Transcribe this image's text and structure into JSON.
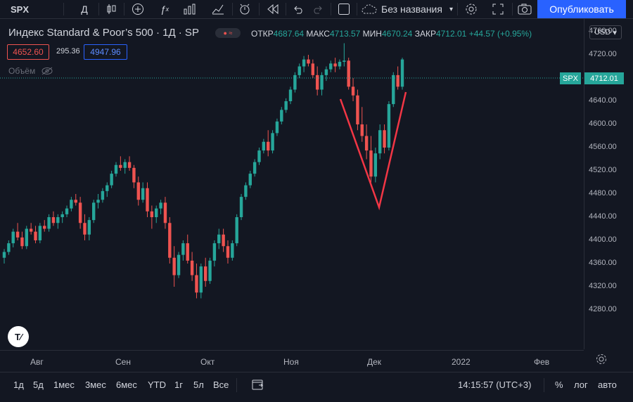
{
  "toolbar": {
    "symbol": "SPX",
    "interval": "Д",
    "layout_name": "Без названия",
    "publish_label": "Опубликовать",
    "icons": [
      "candles-icon",
      "add-indicator-icon",
      "indicators-icon",
      "templates-icon",
      "layout-icon",
      "alert-icon",
      "replay-icon",
      "undo-icon",
      "redo-icon",
      "fullscreen-icon",
      "settings-icon",
      "expand-icon",
      "snapshot-icon"
    ]
  },
  "legend": {
    "title": "Индекс Standard & Poor’s 500 · 1Д · SP",
    "open_label": "ОТКР",
    "open": "4687.64",
    "high_label": "МАКС",
    "high": "4713.57",
    "low_label": "МИН",
    "low": "4670.24",
    "close_label": "ЗАКР",
    "close": "4712.01",
    "change": "+44.57 (+0.95%)",
    "sell_price": "4652.60",
    "spread": "295.36",
    "buy_price": "4947.96",
    "volume_label": "Объём"
  },
  "price_axis": {
    "currency": "USD",
    "ticks": [
      "4760.00",
      "4720.00",
      "4680.00",
      "4640.00",
      "4600.00",
      "4560.00",
      "4520.00",
      "4480.00",
      "4440.00",
      "4400.00",
      "4360.00",
      "4320.00",
      "4280.00"
    ],
    "symbol_tag": "SPX",
    "last_price": "4712.01"
  },
  "time_axis": {
    "ticks": [
      "Авг",
      "Сен",
      "Окт",
      "Ноя",
      "Дек",
      "2022",
      "Фев"
    ]
  },
  "bottom": {
    "ranges": [
      "1д",
      "5д",
      "1мес",
      "3мес",
      "6мес",
      "YTD",
      "1г",
      "5л",
      "Все"
    ],
    "time": "14:15:57 (UTC+3)",
    "percent": "%",
    "log": "лог",
    "auto": "авто"
  },
  "chart_data": {
    "type": "candlestick",
    "y_range": [
      4260,
      4780
    ],
    "up_color": "#26a69a",
    "down_color": "#ef5350",
    "annotation": "red V-shape drawing",
    "candles": [
      [
        4370,
        4385,
        4360,
        4380
      ],
      [
        4380,
        4400,
        4375,
        4395
      ],
      [
        4395,
        4420,
        4388,
        4415
      ],
      [
        4415,
        4430,
        4400,
        4405
      ],
      [
        4405,
        4415,
        4385,
        4390
      ],
      [
        4390,
        4425,
        4385,
        4420
      ],
      [
        4420,
        4430,
        4410,
        4415
      ],
      [
        4415,
        4425,
        4395,
        4400
      ],
      [
        4400,
        4430,
        4395,
        4425
      ],
      [
        4425,
        4435,
        4415,
        4420
      ],
      [
        4420,
        4445,
        4415,
        4440
      ],
      [
        4440,
        4450,
        4425,
        4430
      ],
      [
        4430,
        4445,
        4420,
        4440
      ],
      [
        4440,
        4450,
        4430,
        4445
      ],
      [
        4445,
        4460,
        4440,
        4455
      ],
      [
        4455,
        4475,
        4450,
        4470
      ],
      [
        4470,
        4480,
        4460,
        4465
      ],
      [
        4465,
        4475,
        4420,
        4430
      ],
      [
        4430,
        4445,
        4400,
        4410
      ],
      [
        4410,
        4440,
        4400,
        4435
      ],
      [
        4435,
        4470,
        4430,
        4465
      ],
      [
        4465,
        4480,
        4455,
        4470
      ],
      [
        4470,
        4490,
        4465,
        4485
      ],
      [
        4485,
        4500,
        4475,
        4495
      ],
      [
        4495,
        4520,
        4490,
        4515
      ],
      [
        4515,
        4535,
        4510,
        4530
      ],
      [
        4530,
        4545,
        4520,
        4525
      ],
      [
        4525,
        4540,
        4515,
        4535
      ],
      [
        4535,
        4545,
        4520,
        4525
      ],
      [
        4525,
        4530,
        4490,
        4500
      ],
      [
        4500,
        4510,
        4460,
        4470
      ],
      [
        4470,
        4500,
        4465,
        4490
      ],
      [
        4490,
        4500,
        4440,
        4450
      ],
      [
        4450,
        4460,
        4420,
        4440
      ],
      [
        4440,
        4460,
        4430,
        4455
      ],
      [
        4455,
        4470,
        4445,
        4465
      ],
      [
        4465,
        4475,
        4420,
        4430
      ],
      [
        4430,
        4440,
        4360,
        4370
      ],
      [
        4370,
        4390,
        4320,
        4340
      ],
      [
        4340,
        4380,
        4335,
        4375
      ],
      [
        4375,
        4400,
        4365,
        4395
      ],
      [
        4395,
        4410,
        4360,
        4365
      ],
      [
        4365,
        4380,
        4330,
        4340
      ],
      [
        4340,
        4360,
        4300,
        4310
      ],
      [
        4310,
        4360,
        4300,
        4355
      ],
      [
        4355,
        4370,
        4320,
        4330
      ],
      [
        4330,
        4370,
        4325,
        4365
      ],
      [
        4365,
        4400,
        4355,
        4395
      ],
      [
        4395,
        4420,
        4385,
        4410
      ],
      [
        4410,
        4420,
        4380,
        4390
      ],
      [
        4390,
        4400,
        4360,
        4370
      ],
      [
        4370,
        4400,
        4365,
        4395
      ],
      [
        4395,
        4445,
        4390,
        4440
      ],
      [
        4440,
        4480,
        4435,
        4475
      ],
      [
        4475,
        4500,
        4470,
        4495
      ],
      [
        4495,
        4520,
        4490,
        4515
      ],
      [
        4515,
        4540,
        4510,
        4535
      ],
      [
        4535,
        4560,
        4530,
        4555
      ],
      [
        4555,
        4575,
        4550,
        4570
      ],
      [
        4570,
        4590,
        4545,
        4555
      ],
      [
        4555,
        4590,
        4550,
        4585
      ],
      [
        4585,
        4610,
        4580,
        4605
      ],
      [
        4605,
        4630,
        4600,
        4625
      ],
      [
        4625,
        4645,
        4620,
        4640
      ],
      [
        4640,
        4665,
        4635,
        4660
      ],
      [
        4660,
        4690,
        4655,
        4685
      ],
      [
        4685,
        4705,
        4680,
        4700
      ],
      [
        4700,
        4718,
        4690,
        4712
      ],
      [
        4712,
        4720,
        4700,
        4705
      ],
      [
        4705,
        4712,
        4680,
        4685
      ],
      [
        4685,
        4700,
        4650,
        4660
      ],
      [
        4660,
        4690,
        4650,
        4685
      ],
      [
        4685,
        4700,
        4675,
        4695
      ],
      [
        4695,
        4710,
        4690,
        4705
      ],
      [
        4705,
        4715,
        4690,
        4700
      ],
      [
        4700,
        4712,
        4695,
        4708
      ],
      [
        4708,
        4740,
        4700,
        4710
      ],
      [
        4710,
        4715,
        4660,
        4665
      ],
      [
        4665,
        4680,
        4640,
        4650
      ],
      [
        4650,
        4660,
        4590,
        4600
      ],
      [
        4600,
        4630,
        4570,
        4580
      ],
      [
        4580,
        4600,
        4540,
        4555
      ],
      [
        4555,
        4580,
        4500,
        4510
      ],
      [
        4510,
        4560,
        4500,
        4550
      ],
      [
        4550,
        4600,
        4540,
        4590
      ],
      [
        4590,
        4600,
        4550,
        4560
      ],
      [
        4560,
        4640,
        4555,
        4635
      ],
      [
        4635,
        4690,
        4630,
        4685
      ],
      [
        4685,
        4700,
        4660,
        4665
      ],
      [
        4665,
        4715,
        4660,
        4712
      ]
    ]
  }
}
